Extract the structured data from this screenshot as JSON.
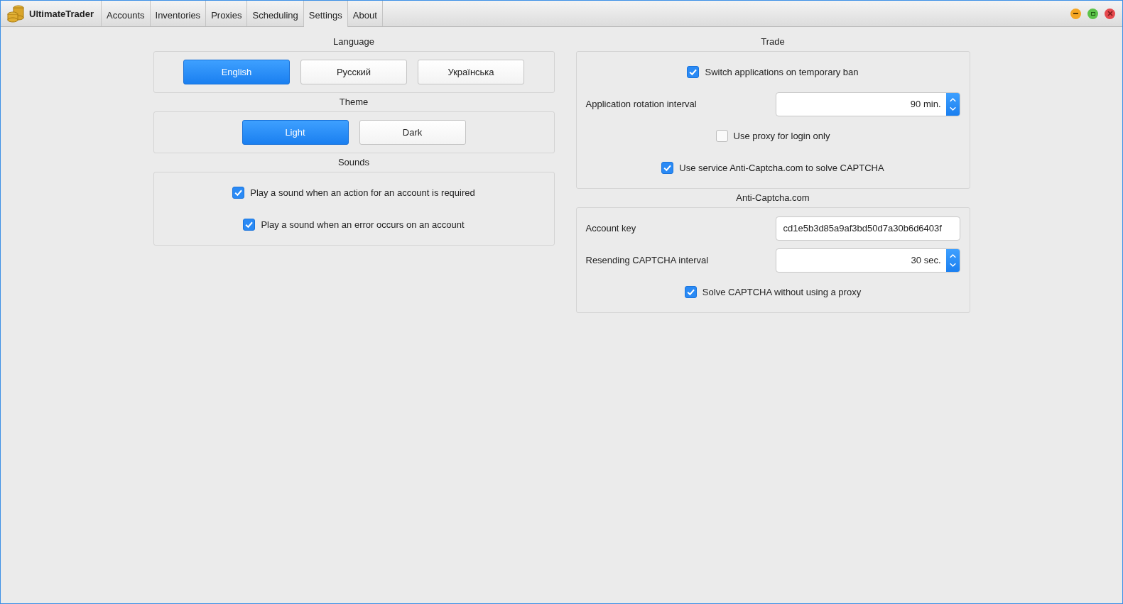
{
  "app": {
    "title": "UltimateTrader"
  },
  "tabs": [
    {
      "label": "Accounts",
      "selected": false
    },
    {
      "label": "Inventories",
      "selected": false
    },
    {
      "label": "Proxies",
      "selected": false
    },
    {
      "label": "Scheduling",
      "selected": false
    },
    {
      "label": "Settings",
      "selected": true
    },
    {
      "label": "About",
      "selected": false
    }
  ],
  "columns": [
    {
      "sections": [
        {
          "title": "Language",
          "rows": [
            {
              "kind": "choice",
              "options": [
                {
                  "label": "English",
                  "selected": true
                },
                {
                  "label": "Русский",
                  "selected": false
                },
                {
                  "label": "Українська",
                  "selected": false
                }
              ]
            }
          ]
        },
        {
          "title": "Theme",
          "rows": [
            {
              "kind": "choice",
              "options": [
                {
                  "label": "Light",
                  "selected": true
                },
                {
                  "label": "Dark",
                  "selected": false
                }
              ]
            }
          ]
        },
        {
          "title": "Sounds",
          "rows": [
            {
              "kind": "checkbox",
              "label": "Play a sound when an action for an account is required",
              "checked": true
            },
            {
              "kind": "checkbox",
              "label": "Play a sound when an error occurs on an account",
              "checked": true
            }
          ]
        }
      ]
    },
    {
      "sections": [
        {
          "title": "Trade",
          "rows": [
            {
              "kind": "checkbox",
              "label": "Switch applications on temporary ban",
              "checked": true
            },
            {
              "kind": "spin",
              "label": "Application rotation interval",
              "value": "90 min."
            },
            {
              "kind": "checkbox",
              "label": "Use proxy for login only",
              "checked": false
            },
            {
              "kind": "checkbox",
              "label": "Use service Anti-Captcha.com to solve CAPTCHA",
              "checked": true
            }
          ]
        },
        {
          "title": "Anti-Captcha.com",
          "rows": [
            {
              "kind": "text",
              "label": "Account key",
              "value": "cd1e5b3d85a9af3bd50d7a30b6d6403f"
            },
            {
              "kind": "spin",
              "label": "Resending CAPTCHA interval",
              "value": "30 sec."
            },
            {
              "kind": "checkbox",
              "label": "Solve CAPTCHA without using a proxy",
              "checked": true
            }
          ]
        }
      ]
    }
  ]
}
